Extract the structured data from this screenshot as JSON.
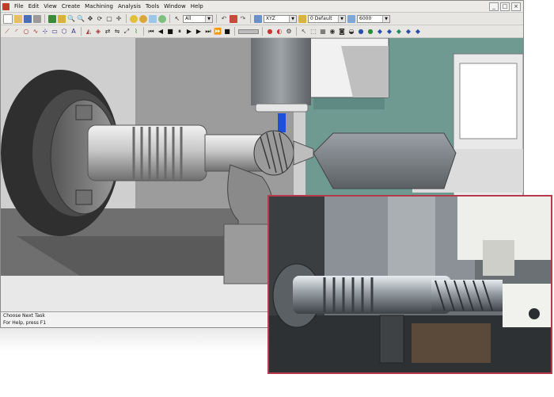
{
  "menu": {
    "items": [
      "File",
      "Edit",
      "View",
      "Create",
      "Machining",
      "Analysis",
      "Tools",
      "Window",
      "Help"
    ]
  },
  "window_controls": {
    "minimize": "_",
    "maximize": "□",
    "close": "×"
  },
  "toolbar": {
    "dropdown_1": "All",
    "dropdown_2": "XYZ",
    "dropdown_3": "0 Default",
    "dropdown_4": "6000"
  },
  "status": {
    "line1": "Choose Next Task",
    "line2": "For Help, press F1"
  },
  "colors": {
    "photo_border": "#b63a4c",
    "machine_teal": "#6f9a92",
    "tool_blue": "#1f4fd8",
    "chrome_bg": "#e7e6e2"
  }
}
